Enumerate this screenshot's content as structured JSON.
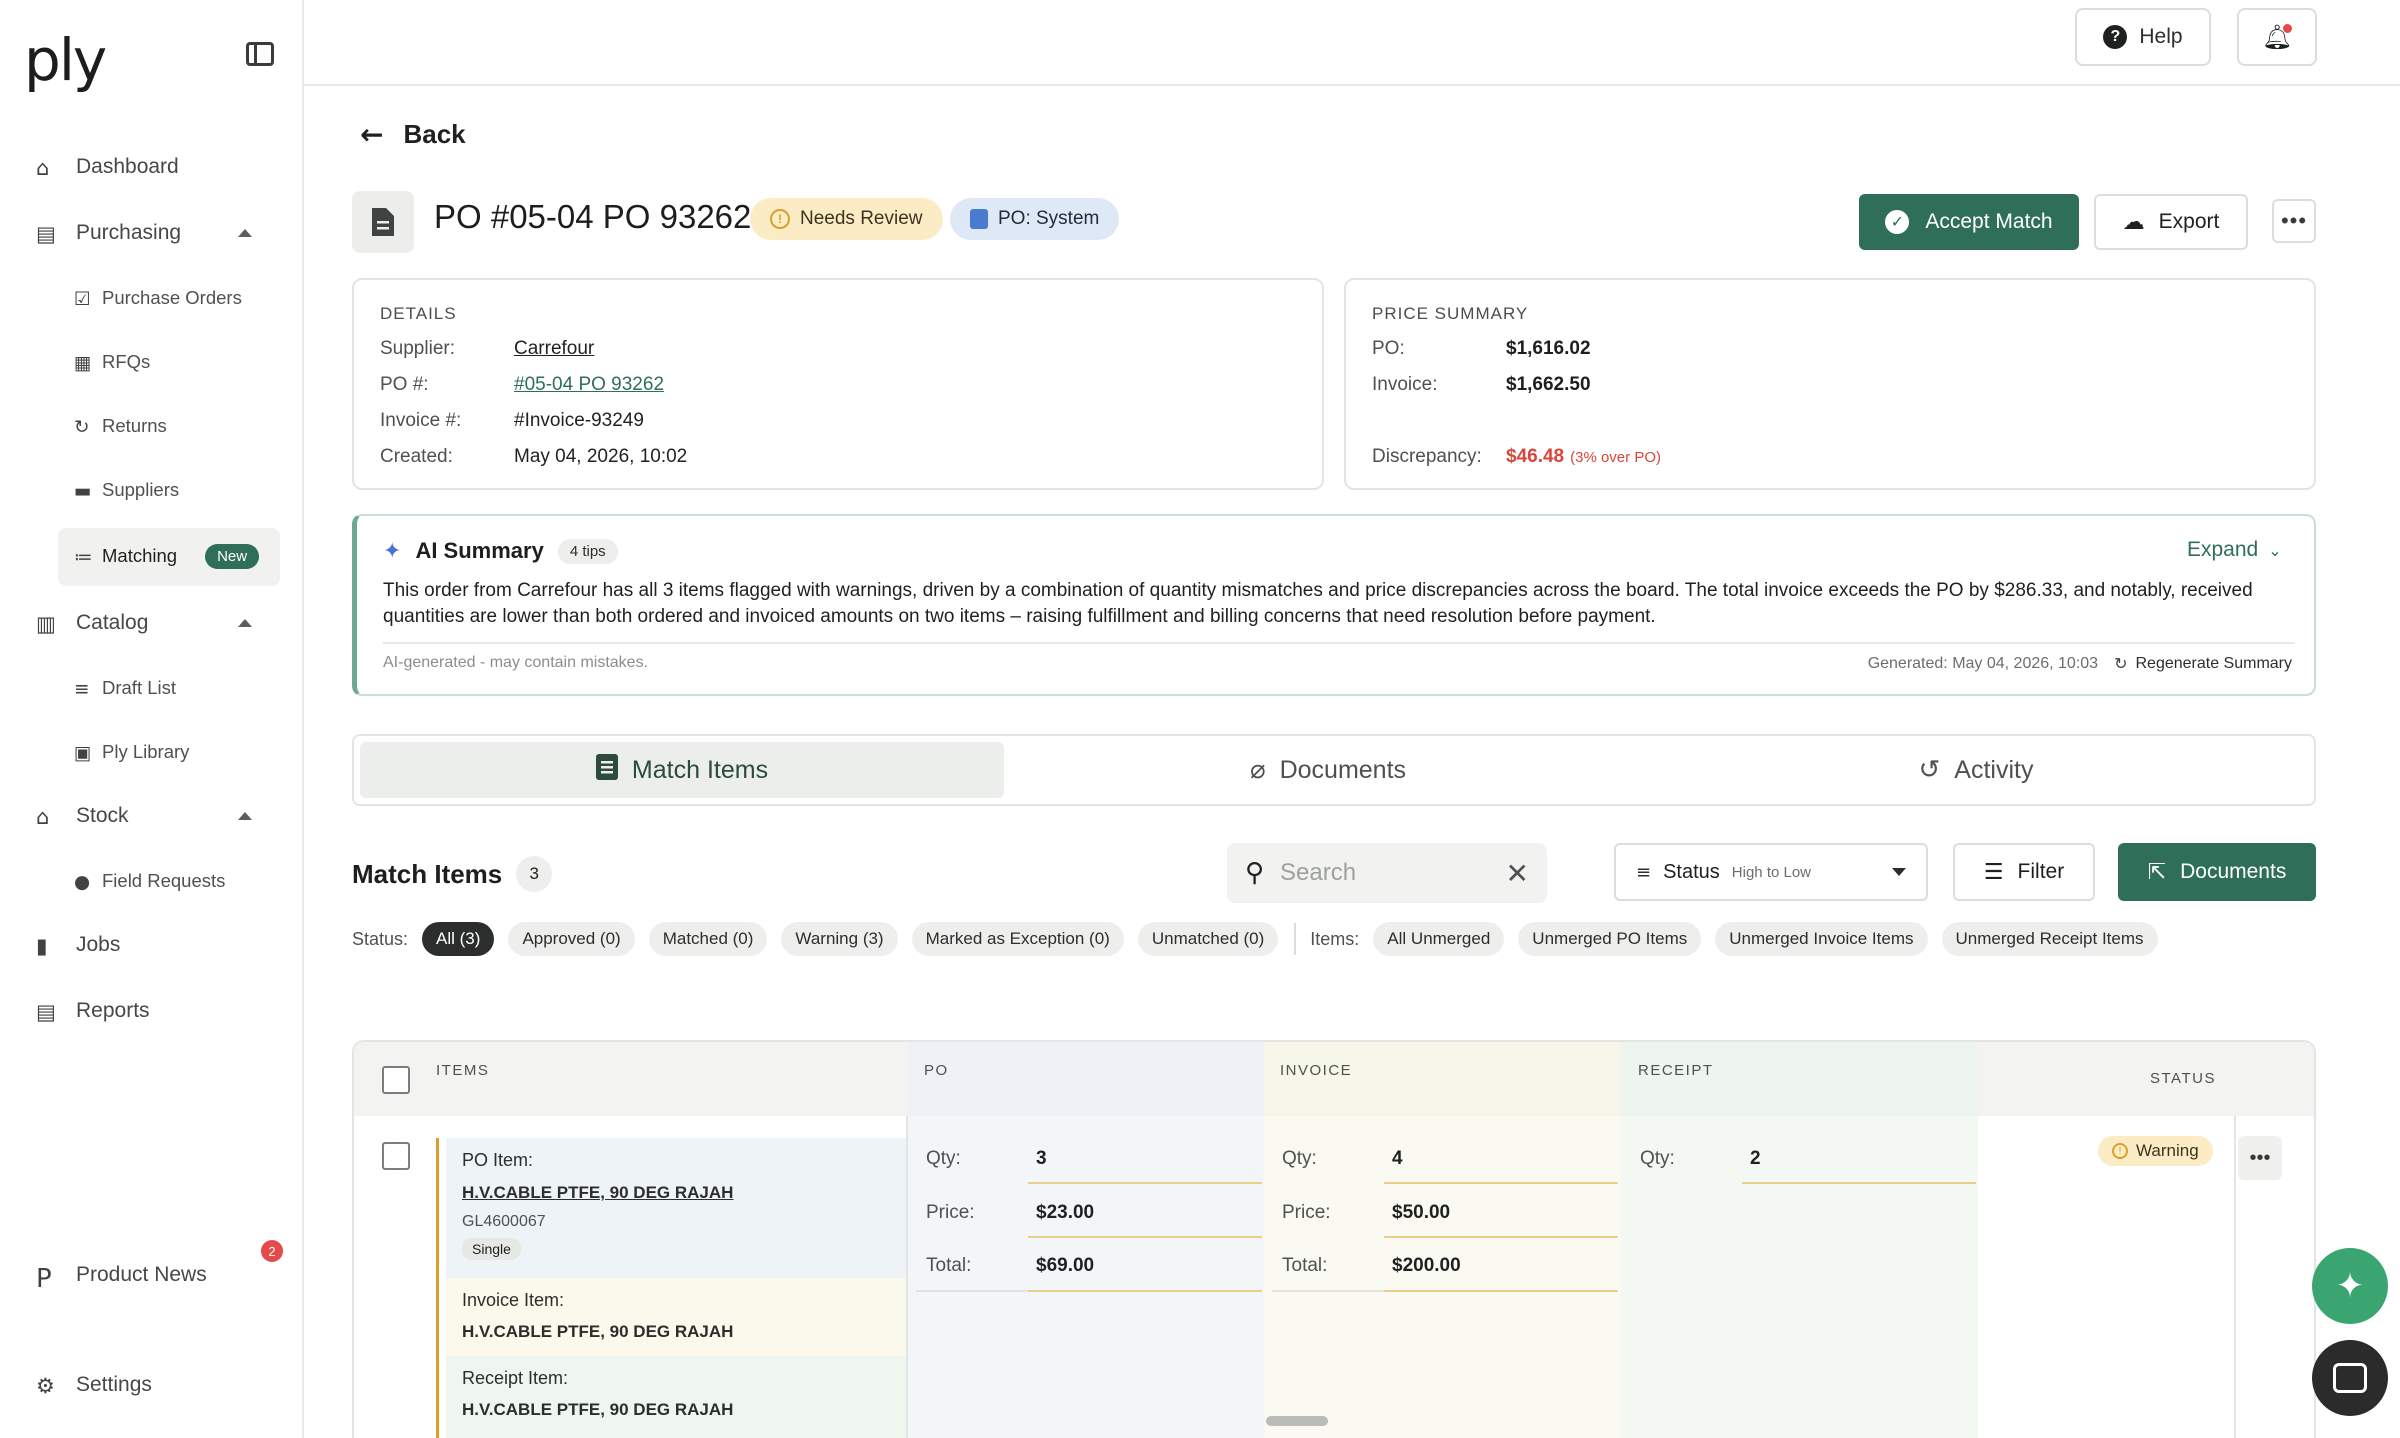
{
  "app": {
    "logo": "ply"
  },
  "sidebar": {
    "items": [
      {
        "label": "Dashboard"
      },
      {
        "label": "Purchasing"
      },
      {
        "label": "Purchase Orders"
      },
      {
        "label": "RFQs"
      },
      {
        "label": "Returns"
      },
      {
        "label": "Suppliers"
      },
      {
        "label": "Matching",
        "badge": "New"
      },
      {
        "label": "Catalog"
      },
      {
        "label": "Draft List"
      },
      {
        "label": "Ply Library"
      },
      {
        "label": "Stock"
      },
      {
        "label": "Field Requests"
      },
      {
        "label": "Jobs"
      },
      {
        "label": "Reports"
      },
      {
        "label": "Product News",
        "badge": "2"
      },
      {
        "label": "Settings"
      }
    ]
  },
  "topbar": {
    "help_label": "Help"
  },
  "header": {
    "back_label": "Back",
    "title": "PO #05-04 PO 93262",
    "status_badge": "Needs Review",
    "source_badge": "PO: System",
    "accept_label": "Accept Match",
    "export_label": "Export"
  },
  "details": {
    "heading": "DETAILS",
    "supplier_label": "Supplier:",
    "supplier": "Carrefour",
    "po_label": "PO #:",
    "po": "#05-04 PO 93262",
    "invoice_label": "Invoice #:",
    "invoice": "#Invoice-93249",
    "created_label": "Created:",
    "created": "May 04, 2026, 10:02"
  },
  "price_summary": {
    "heading": "PRICE SUMMARY",
    "po_label": "PO:",
    "po": "$1,616.02",
    "invoice_label": "Invoice:",
    "invoice": "$1,662.50",
    "discrepancy_label": "Discrepancy:",
    "discrepancy": "$46.48",
    "discrepancy_note": "(3% over PO)"
  },
  "ai_summary": {
    "title": "AI Summary",
    "tips": "4 tips",
    "expand_label": "Expand",
    "text": "This order from Carrefour has all 3 items flagged with warnings, driven by a combination of quantity mismatches and price discrepancies across the board. The total invoice exceeds the PO by $286.33, and notably, received quantities are lower than both ordered and invoiced amounts on two items – raising fulfillment and billing concerns that need resolution before payment.",
    "disclaimer": "AI-generated - may contain mistakes.",
    "generated": "Generated: May 04, 2026, 10:03",
    "regenerate_label": "Regenerate Summary"
  },
  "tabs": [
    {
      "label": "Match Items"
    },
    {
      "label": "Documents"
    },
    {
      "label": "Activity"
    }
  ],
  "match_items": {
    "title": "Match Items",
    "count": "3",
    "search_placeholder": "Search",
    "sort_label": "Status",
    "sort_sub": "High to Low",
    "filter_label": "Filter",
    "documents_label": "Documents",
    "status_label": "Status:",
    "status_chips": [
      "All (3)",
      "Approved (0)",
      "Matched (0)",
      "Warning (3)",
      "Marked as Exception (0)",
      "Unmatched (0)"
    ],
    "items_label": "Items:",
    "item_chips": [
      "All Unmerged",
      "Unmerged PO Items",
      "Unmerged Invoice Items",
      "Unmerged Receipt Items"
    ]
  },
  "table": {
    "columns": [
      "ITEMS",
      "PO",
      "INVOICE",
      "RECEIPT",
      "STATUS"
    ],
    "rows": [
      {
        "po_item_label": "PO Item:",
        "po_item_name": "H.V.CABLE PTFE, 90 DEG RAJAH",
        "po_item_code": "GL4600067",
        "po_item_tag": "Single",
        "invoice_item_label": "Invoice Item:",
        "invoice_item_name": "H.V.CABLE PTFE, 90 DEG RAJAH",
        "receipt_item_label": "Receipt Item:",
        "receipt_item_name": "H.V.CABLE PTFE, 90 DEG RAJAH",
        "qty_label": "Qty:",
        "price_label": "Price:",
        "total_label": "Total:",
        "po": {
          "qty": "3",
          "price": "$23.00",
          "total": "$69.00"
        },
        "invoice": {
          "qty": "4",
          "price": "$50.00",
          "total": "$200.00"
        },
        "receipt": {
          "qty": "2"
        },
        "status": "Warning"
      }
    ]
  },
  "colors": {
    "brand_green": "#2f6e58",
    "warning": "#d8a02b",
    "discrepancy_red": "#d9473a",
    "ai_blue": "#4a72d8"
  }
}
